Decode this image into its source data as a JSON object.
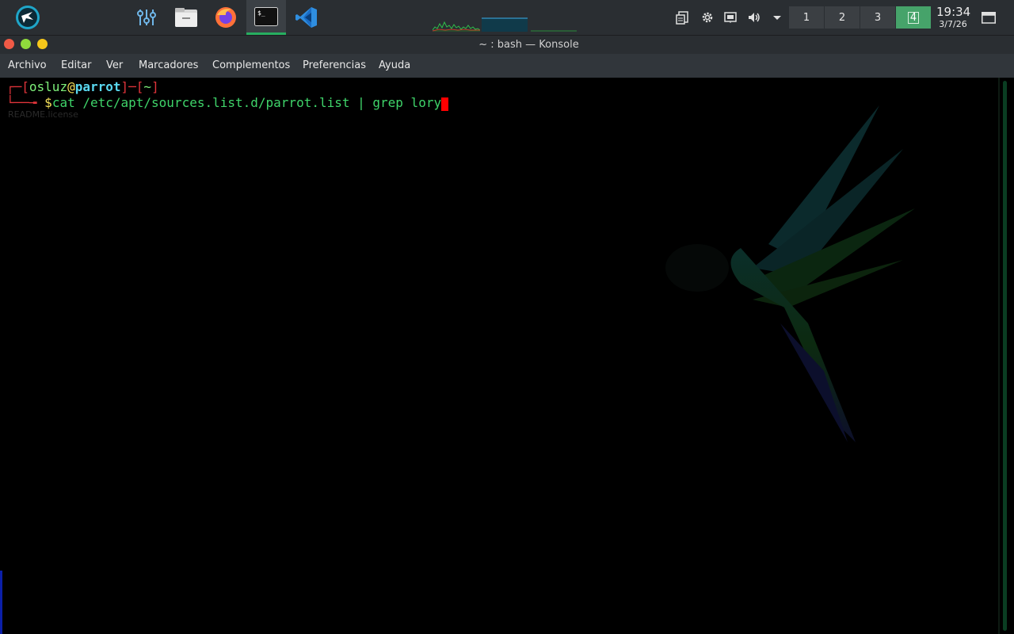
{
  "panel": {
    "launchers": [
      {
        "name": "parrot-menu-icon"
      },
      {
        "name": "mixer-settings-icon"
      },
      {
        "name": "file-manager-icon"
      },
      {
        "name": "firefox-icon"
      },
      {
        "name": "terminal-icon"
      },
      {
        "name": "vscode-icon"
      }
    ],
    "desktops": [
      "1",
      "2",
      "3",
      "4"
    ],
    "active_desktop": "4",
    "clock_time": "19:34",
    "clock_date": "3/7/26"
  },
  "window": {
    "title": "~ : bash — Konsole"
  },
  "menu": [
    "Archivo",
    "Editar",
    "Ver",
    "Marcadores",
    "Complementos",
    "Preferencias",
    "Ayuda"
  ],
  "terminal": {
    "prompt_user": "osluz",
    "prompt_at": "@",
    "prompt_host": "parrot",
    "prompt_dir": "~",
    "prompt_symbol": "$",
    "command": "cat /etc/apt/sources.list.d/parrot.list | grep lory",
    "ghost_text": "README.license"
  },
  "colors": {
    "prompt_red": "#e0343a",
    "user_green": "#7ef07a",
    "host_cyan": "#5ad8f0",
    "at_yellow": "#f5e15a",
    "command_green": "#3fd46a",
    "cursor": "#ff0000",
    "active_desktop": "#46a36a"
  }
}
